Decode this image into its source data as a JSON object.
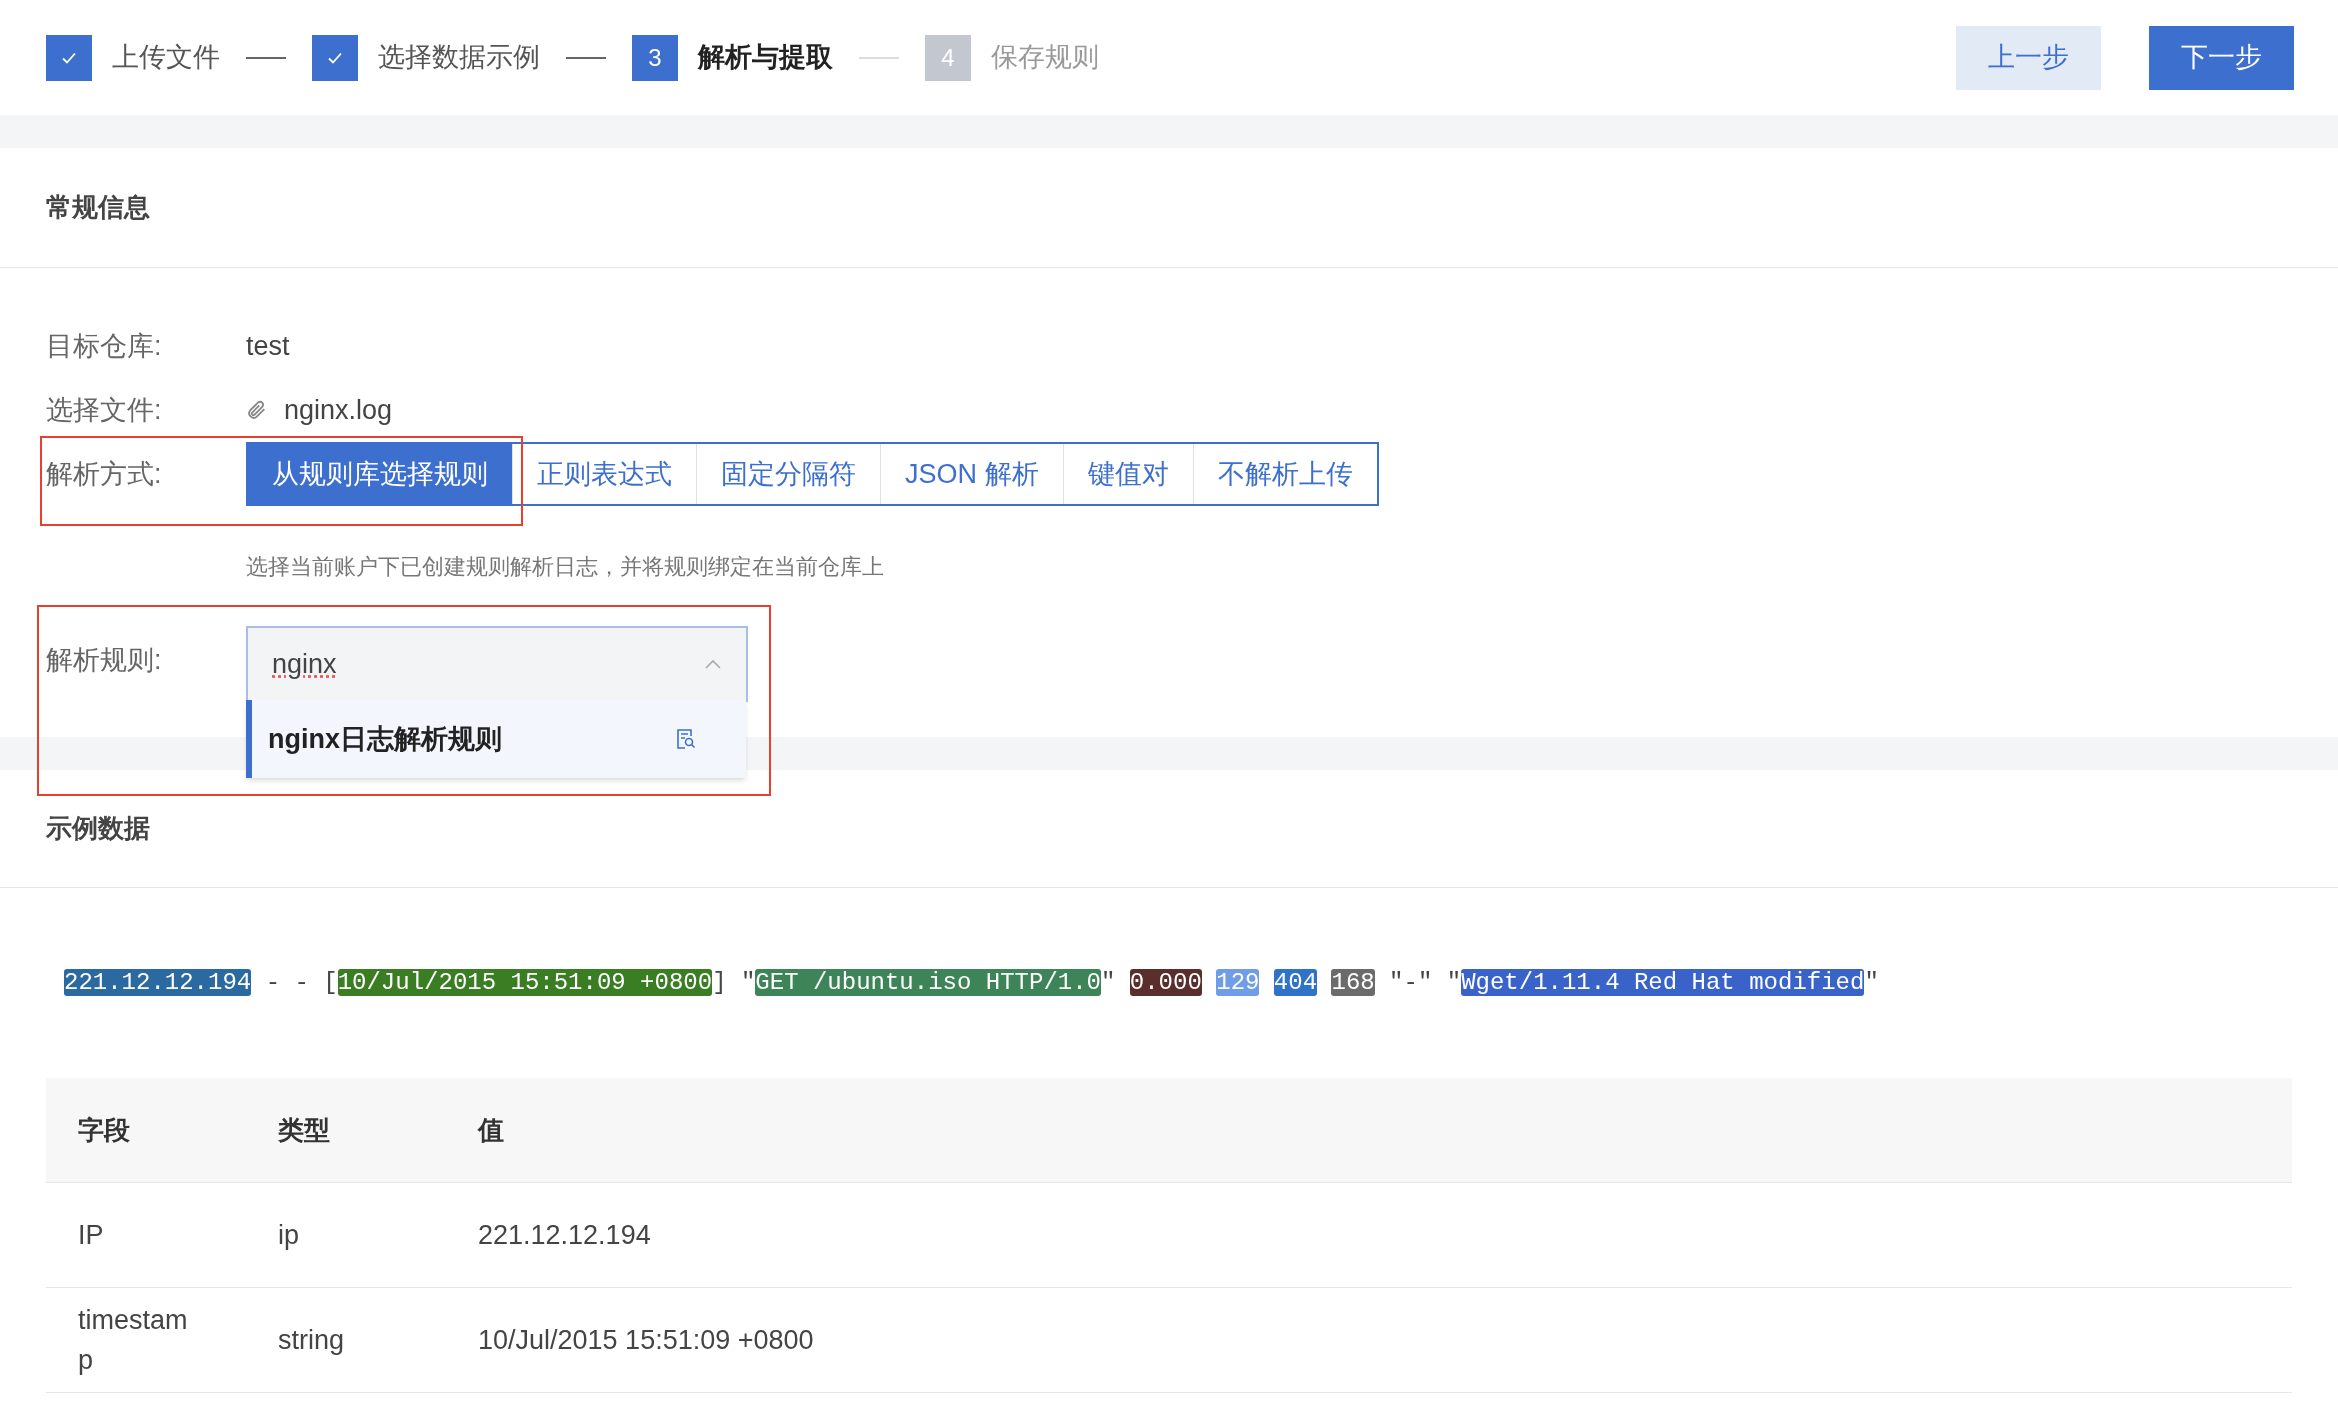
{
  "steps": [
    {
      "label": "上传文件",
      "done": true,
      "current": false
    },
    {
      "label": "选择数据示例",
      "done": true,
      "current": false
    },
    {
      "label": "解析与提取",
      "number": "3",
      "done": false,
      "current": true
    },
    {
      "label": "保存规则",
      "number": "4",
      "done": false,
      "current": false
    }
  ],
  "nav_buttons": [
    {
      "label": "上一步",
      "kind": "secondary"
    },
    {
      "label": "下一步",
      "kind": "primary"
    }
  ],
  "general_section": {
    "title": "常规信息",
    "fields": [
      {
        "kind": "text",
        "label": "目标仓库:",
        "value": "test"
      },
      {
        "kind": "file",
        "label": "选择文件:",
        "value": "nginx.log"
      }
    ],
    "parse_mode": {
      "label": "解析方式:",
      "options": [
        {
          "label": "从规则库选择规则",
          "selected": true
        },
        {
          "label": "正则表达式",
          "selected": false
        },
        {
          "label": "固定分隔符",
          "selected": false
        },
        {
          "label": "JSON 解析",
          "selected": false
        },
        {
          "label": "键值对",
          "selected": false
        },
        {
          "label": "不解析上传",
          "selected": false
        }
      ],
      "hint": "选择当前账户下已创建规则解析日志，并将规则绑定在当前仓库上"
    },
    "parse_rule": {
      "label": "解析规则:",
      "value": "nginx",
      "expanded": true,
      "options": [
        {
          "label": "nginx日志解析规则",
          "selected": true
        }
      ]
    }
  },
  "sample_section": {
    "title": "示例数据",
    "log_segments": [
      {
        "kind": "token",
        "text": "221.12.12.194",
        "color": "#2b6aa0"
      },
      {
        "kind": "plain",
        "text": " - - ["
      },
      {
        "kind": "token",
        "text": "10/Jul/2015 15:51:09 +0800",
        "color": "#3a7d22"
      },
      {
        "kind": "plain",
        "text": "] \""
      },
      {
        "kind": "token",
        "text": "GET /ubuntu.iso HTTP/1.0",
        "color": "#3d8559"
      },
      {
        "kind": "plain",
        "text": "\" "
      },
      {
        "kind": "token",
        "text": "0.000",
        "color": "#5a2e2a"
      },
      {
        "kind": "token",
        "text": "129",
        "color": "#6f9de8",
        "space_before": true
      },
      {
        "kind": "token",
        "text": "404",
        "color": "#2f73c9",
        "space_before": true
      },
      {
        "kind": "token",
        "text": "168",
        "color": "#6b6b6b",
        "space_before": true
      },
      {
        "kind": "plain",
        "text": " \"-\" \""
      },
      {
        "kind": "token",
        "text": "Wget/1.11.4 Red Hat modified",
        "color": "#3a63c9"
      },
      {
        "kind": "plain",
        "text": "\""
      }
    ],
    "table": {
      "columns": [
        "字段",
        "类型",
        "值"
      ],
      "rows": [
        [
          "IP",
          "ip",
          "221.12.12.194"
        ],
        [
          "timestamp",
          "string",
          "10/Jul/2015 15:51:09 +0800"
        ]
      ]
    }
  }
}
